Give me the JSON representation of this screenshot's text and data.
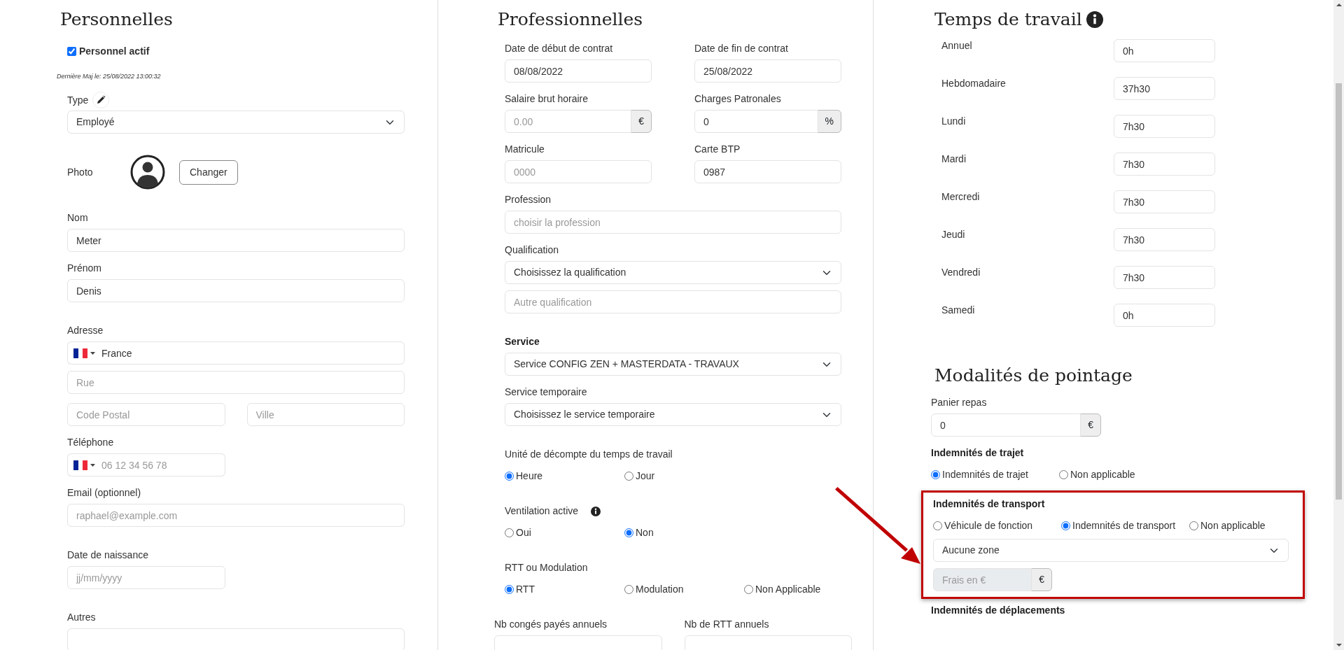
{
  "columns": [
    {
      "sections": [
        [
          {
            "kind": "heading",
            "text": "Personnelles"
          },
          {
            "kind": "checkbox",
            "label": "Personnel actif",
            "checked": true
          },
          {
            "kind": "note",
            "text": "Dernière Maj le: 25/08/2022 13:00:32"
          },
          {
            "kind": "field_edit",
            "label": "Type",
            "control": {
              "kind": "select",
              "value": "Employé"
            }
          }
        ],
        [
          {
            "kind": "photo",
            "label": "Photo",
            "button": "Changer"
          }
        ],
        [
          {
            "kind": "field",
            "label": "Nom",
            "control": {
              "kind": "text",
              "value": "Meter"
            }
          },
          {
            "kind": "field",
            "label": "Prénom",
            "control": {
              "kind": "text",
              "value": "Denis"
            }
          }
        ],
        [
          {
            "kind": "field",
            "label": "Adresse",
            "control": {
              "kind": "flag",
              "value": "France"
            }
          },
          {
            "kind": "field",
            "control": {
              "kind": "text",
              "placeholder": "Rue"
            }
          },
          {
            "kind": "row",
            "fields": [
              {
                "kind": "field",
                "control": {
                  "kind": "text",
                  "placeholder": "Code Postal"
                }
              },
              {
                "kind": "field",
                "control": {
                  "kind": "text",
                  "placeholder": "Ville"
                }
              }
            ]
          },
          {
            "kind": "row",
            "fields": [
              {
                "kind": "field",
                "label": "Téléphone",
                "control": {
                  "kind": "flag",
                  "placeholder": "06 12 34 56 78"
                }
              }
            ]
          },
          {
            "kind": "field",
            "label": "Email (optionnel)",
            "control": {
              "kind": "text",
              "placeholder": "raphael@example.com"
            }
          }
        ],
        [
          {
            "kind": "row",
            "fields": [
              {
                "kind": "field",
                "label": "Date de naissance",
                "control": {
                  "kind": "text",
                  "placeholder": "jj/mm/yyyy"
                }
              }
            ]
          }
        ],
        [
          {
            "kind": "field",
            "label": "Autres",
            "control": {
              "kind": "text"
            }
          }
        ]
      ]
    },
    {
      "sections": [
        [
          {
            "kind": "heading",
            "text": "Professionnelles"
          },
          {
            "kind": "row",
            "fields": [
              {
                "kind": "field",
                "label": "Date de début de contrat",
                "control": {
                  "kind": "text",
                  "value": "08/08/2022"
                }
              },
              {
                "kind": "field",
                "label": "Date de fin de contrat",
                "control": {
                  "kind": "text",
                  "value": "25/08/2022"
                }
              }
            ]
          },
          {
            "kind": "row",
            "fields": [
              {
                "kind": "field",
                "label": "Salaire brut horaire",
                "control": {
                  "kind": "addon",
                  "placeholder": "0.00",
                  "addon": "€"
                }
              },
              {
                "kind": "field",
                "label": "Charges Patronales",
                "control": {
                  "kind": "addon",
                  "value": "0",
                  "addon": "%"
                }
              }
            ]
          },
          {
            "kind": "row",
            "fields": [
              {
                "kind": "field",
                "label": "Matricule",
                "control": {
                  "kind": "text",
                  "placeholder": "0000"
                }
              },
              {
                "kind": "field",
                "label": "Carte BTP",
                "control": {
                  "kind": "text",
                  "value": "0987"
                }
              }
            ]
          },
          {
            "kind": "field",
            "label": "Profession",
            "control": {
              "kind": "text",
              "placeholder": "choisir la profession"
            }
          },
          {
            "kind": "field",
            "label": "Qualification",
            "control": {
              "kind": "select",
              "value": "Choisissez la qualification"
            }
          },
          {
            "kind": "field",
            "control": {
              "kind": "text",
              "placeholder": "Autre qualification"
            }
          }
        ],
        [
          {
            "kind": "field_bold",
            "label": "Service",
            "control": {
              "kind": "select",
              "value": "Service CONFIG ZEN + MASTERDATA - TRAVAUX"
            }
          },
          {
            "kind": "field",
            "label": "Service temporaire",
            "control": {
              "kind": "select",
              "value": "Choisissez le service temporaire"
            }
          }
        ],
        [
          {
            "kind": "field",
            "label": "Unité de décompte du temps de travail",
            "control": {
              "kind": "radios",
              "options": [
                {
                  "label": "Heure",
                  "selected": true
                },
                {
                  "label": "Jour",
                  "selected": false
                }
              ]
            }
          }
        ],
        [
          {
            "kind": "field_info",
            "label": "Ventilation active",
            "control": {
              "kind": "radios",
              "options": [
                {
                  "label": "Oui",
                  "selected": false
                },
                {
                  "label": "Non",
                  "selected": true
                }
              ]
            }
          }
        ],
        [
          {
            "kind": "field",
            "label": "RTT ou Modulation",
            "control": {
              "kind": "radios",
              "options": [
                {
                  "label": "RTT",
                  "selected": true
                },
                {
                  "label": "Modulation",
                  "selected": false
                },
                {
                  "label": "Non Applicable",
                  "selected": false
                }
              ]
            }
          }
        ],
        [
          {
            "kind": "row",
            "fields": [
              {
                "kind": "field",
                "label": "Nb congés payés annuels",
                "control": {
                  "kind": "text"
                }
              },
              {
                "kind": "field",
                "label": "Nb de RTT annuels",
                "control": {
                  "kind": "text"
                }
              }
            ]
          }
        ]
      ]
    },
    {
      "sections": [
        [
          {
            "kind": "heading_info",
            "text": "Temps de travail"
          },
          {
            "kind": "inline",
            "label": "Annuel",
            "value": "0h"
          },
          {
            "kind": "inline",
            "label": "Hebdomadaire",
            "value": "37h30"
          },
          {
            "kind": "inline",
            "label": "Lundi",
            "value": "7h30"
          },
          {
            "kind": "inline",
            "label": "Mardi",
            "value": "7h30"
          },
          {
            "kind": "inline",
            "label": "Mercredi",
            "value": "7h30"
          },
          {
            "kind": "inline",
            "label": "Jeudi",
            "value": "7h30"
          },
          {
            "kind": "inline",
            "label": "Vendredi",
            "value": "7h30"
          },
          {
            "kind": "inline",
            "label": "Samedi",
            "value": "0h"
          }
        ],
        [
          {
            "kind": "heading",
            "text": "Modalités de pointage"
          },
          {
            "kind": "field",
            "label": "Panier repas",
            "control": {
              "kind": "addon",
              "value": "0",
              "addon": "€"
            }
          },
          {
            "kind": "field_bold",
            "label": "Indemnités de trajet",
            "control": {
              "kind": "radios",
              "options": [
                {
                  "label": "Indemnités de trajet",
                  "selected": true
                },
                {
                  "label": "Non applicable",
                  "selected": false
                }
              ]
            }
          },
          {
            "kind": "group",
            "highlighted": true,
            "items": [
              {
                "kind": "field_bold",
                "label": "Indemnités de transport",
                "control": {
                  "kind": "radios",
                  "options": [
                    {
                      "label": "Véhicule de fonction",
                      "selected": false
                    },
                    {
                      "label": "Indemnités de transport",
                      "selected": true
                    },
                    {
                      "label": "Non applicable",
                      "selected": false
                    }
                  ]
                }
              },
              {
                "kind": "field",
                "control": {
                  "kind": "select",
                  "value": "Aucune zone"
                }
              },
              {
                "kind": "field",
                "control": {
                  "kind": "addon",
                  "placeholder": "Frais en €",
                  "addon": "€",
                  "disabled": true
                }
              }
            ]
          },
          {
            "kind": "field_bold",
            "label": "Indemnités de déplacements"
          }
        ]
      ]
    }
  ]
}
